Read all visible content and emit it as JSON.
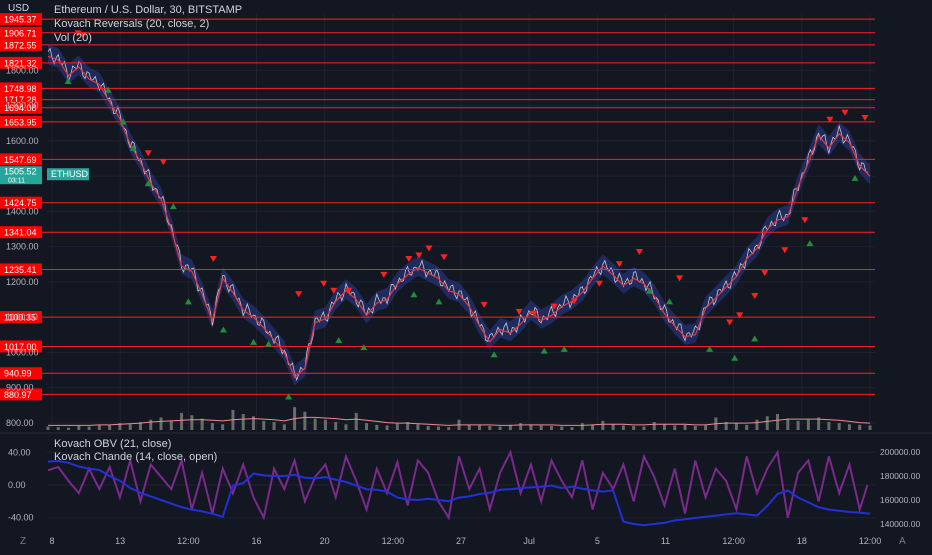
{
  "header": {
    "price_unit": "USD",
    "legend": [
      "Ethereum / U.S. Dollar, 30, BITSTAMP",
      "Kovach Reversals (20, close, 2)",
      "Vol (20)"
    ],
    "lower_legend": [
      "Kovach OBV (21, close)",
      "Kovach Chande (14, close, open)"
    ]
  },
  "footer": {
    "left_btn": "Z",
    "right_btn": "A"
  },
  "colors": {
    "background": "#131722",
    "level_line": "#ff1f1f",
    "level_label_bg": "#ff0000",
    "price_line": "#c9c9c9",
    "channel": "#2a3a8f",
    "signal_line": "#e8383d",
    "sell_marker": "#ff2020",
    "buy_marker": "#1f8f3a",
    "volume": "#6b6b6b",
    "volume_ma": "#f08a8a",
    "chande": "#7a2a8c",
    "obv": "#2230d8",
    "current_price_bg": "#26a69a"
  },
  "chart_data": [
    {
      "type": "line",
      "title": "Ethereum / U.S. Dollar, 30, BITSTAMP",
      "ylabel": "USD",
      "ylim": [
        780,
        1960
      ],
      "yticks": [
        800,
        900,
        1000,
        1100,
        1200,
        1300,
        1400,
        1500,
        1600,
        1700,
        1800
      ],
      "ytick_labels": [
        "800.00",
        "900.00",
        "1000.00",
        "1100.00",
        "1200.00",
        "1300.00",
        "1400.00",
        "1500.00",
        "1600.00",
        "1700.00",
        "1800.00"
      ],
      "grid": true,
      "x_ticks": [
        "8",
        "13",
        "12:00",
        "16",
        "20",
        "12:00",
        "27",
        "Jul",
        "5",
        "11",
        "12:00",
        "18",
        "12:00"
      ],
      "horizontal_levels": [
        1945.37,
        1906.71,
        1872.55,
        1821.32,
        1748.98,
        1717.28,
        1694.08,
        1653.95,
        1547.69,
        1424.75,
        1341.04,
        1235.41,
        1100.35,
        1017.0,
        940.99,
        880.97
      ],
      "last_price": {
        "label": "ETHUSD",
        "value": "1505.52",
        "countdown": "03:11"
      },
      "series": [
        {
          "values": [
            1845,
            1835,
            1790,
            1815,
            1780,
            1765,
            1715,
            1668,
            1595,
            1545,
            1485,
            1440,
            1355,
            1250,
            1235,
            1170,
            1095,
            1215,
            1175,
            1125,
            1105,
            1075,
            1040,
            1005,
            935,
            960,
            1090,
            1100,
            1150,
            1180,
            1155,
            1110,
            1145,
            1155,
            1200,
            1225,
            1245,
            1230,
            1215,
            1180,
            1170,
            1135,
            1080,
            1035,
            1070,
            1060,
            1085,
            1120,
            1095,
            1110,
            1135,
            1150,
            1175,
            1215,
            1250,
            1225,
            1195,
            1215,
            1200,
            1165,
            1115,
            1080,
            1050,
            1055,
            1130,
            1160,
            1190,
            1220,
            1270,
            1300,
            1355,
            1380,
            1390,
            1475,
            1545,
            1620,
            1585,
            1625,
            1600,
            1535,
            1505
          ]
        }
      ],
      "sell_signals": [
        {
          "x": 6,
          "y": 1905
        },
        {
          "x": 7,
          "y": 1900
        },
        {
          "x": 20,
          "y": 1565
        },
        {
          "x": 23,
          "y": 1540
        },
        {
          "x": 33,
          "y": 1265
        },
        {
          "x": 50,
          "y": 1165
        },
        {
          "x": 55,
          "y": 1195
        },
        {
          "x": 57,
          "y": 1175
        },
        {
          "x": 60,
          "y": 1175
        },
        {
          "x": 67,
          "y": 1220
        },
        {
          "x": 72,
          "y": 1265
        },
        {
          "x": 74,
          "y": 1275
        },
        {
          "x": 76,
          "y": 1295
        },
        {
          "x": 79,
          "y": 1270
        },
        {
          "x": 87,
          "y": 1135
        },
        {
          "x": 94,
          "y": 1115
        },
        {
          "x": 97,
          "y": 1110
        },
        {
          "x": 101,
          "y": 1130
        },
        {
          "x": 105,
          "y": 1145
        },
        {
          "x": 110,
          "y": 1195
        },
        {
          "x": 114,
          "y": 1250
        },
        {
          "x": 118,
          "y": 1285
        },
        {
          "x": 126,
          "y": 1210
        },
        {
          "x": 136,
          "y": 1085
        },
        {
          "x": 138,
          "y": 1105
        },
        {
          "x": 141,
          "y": 1160
        },
        {
          "x": 143,
          "y": 1225
        },
        {
          "x": 147,
          "y": 1290
        },
        {
          "x": 151,
          "y": 1375
        },
        {
          "x": 156,
          "y": 1660
        },
        {
          "x": 159,
          "y": 1680
        },
        {
          "x": 163,
          "y": 1665
        }
      ],
      "buy_signals": [
        {
          "x": 4,
          "y": 1770
        },
        {
          "x": 12,
          "y": 1745
        },
        {
          "x": 15,
          "y": 1655
        },
        {
          "x": 17,
          "y": 1580
        },
        {
          "x": 20,
          "y": 1480
        },
        {
          "x": 25,
          "y": 1415
        },
        {
          "x": 28,
          "y": 1145
        },
        {
          "x": 35,
          "y": 1065
        },
        {
          "x": 41,
          "y": 1030
        },
        {
          "x": 44,
          "y": 1025
        },
        {
          "x": 48,
          "y": 875
        },
        {
          "x": 58,
          "y": 1035
        },
        {
          "x": 63,
          "y": 1015
        },
        {
          "x": 73,
          "y": 1165
        },
        {
          "x": 78,
          "y": 1145
        },
        {
          "x": 89,
          "y": 995
        },
        {
          "x": 99,
          "y": 1005
        },
        {
          "x": 103,
          "y": 1010
        },
        {
          "x": 120,
          "y": 1175
        },
        {
          "x": 124,
          "y": 1145
        },
        {
          "x": 132,
          "y": 1010
        },
        {
          "x": 137,
          "y": 985
        },
        {
          "x": 141,
          "y": 1040
        },
        {
          "x": 152,
          "y": 1310
        },
        {
          "x": 161,
          "y": 1495
        }
      ]
    },
    {
      "type": "bar",
      "title": "Vol (20)",
      "values": [
        6,
        5,
        4,
        7,
        6,
        9,
        8,
        12,
        10,
        14,
        18,
        22,
        16,
        30,
        26,
        20,
        12,
        10,
        35,
        28,
        24,
        16,
        14,
        10,
        40,
        32,
        20,
        18,
        14,
        10,
        30,
        12,
        9,
        8,
        11,
        14,
        10,
        7,
        6,
        5,
        18,
        9,
        8,
        7,
        6,
        9,
        12,
        10,
        8,
        7,
        6,
        5,
        12,
        9,
        16,
        10,
        8,
        7,
        6,
        14,
        10,
        8,
        9,
        7,
        8,
        22,
        14,
        12,
        9,
        18,
        24,
        28,
        20,
        16,
        18,
        22,
        14,
        12,
        10,
        9,
        8
      ],
      "ma": [
        8,
        8,
        8,
        8,
        8,
        9,
        9,
        10,
        11,
        12,
        14,
        15,
        16,
        17,
        18,
        18,
        17,
        16,
        18,
        19,
        20,
        19,
        18,
        16,
        20,
        22,
        22,
        21,
        20,
        18,
        19,
        17,
        15,
        13,
        12,
        12,
        11,
        10,
        9,
        8,
        9,
        9,
        9,
        9,
        8,
        8,
        9,
        9,
        9,
        9,
        8,
        8,
        8,
        9,
        10,
        10,
        10,
        9,
        9,
        10,
        10,
        10,
        10,
        9,
        9,
        11,
        12,
        12,
        12,
        13,
        15,
        17,
        19,
        19,
        19,
        19,
        18,
        17,
        15,
        13,
        12
      ]
    },
    {
      "type": "line",
      "title": "Kovach OBV (21, close) / Kovach Chande (14, close, open)",
      "ylim_left": [
        -55,
        55
      ],
      "yticks_left": [
        "40.00",
        "0.00",
        "-40.00"
      ],
      "ylim_right": [
        135000,
        210000
      ],
      "yticks_right": [
        "200000.00",
        "180000.00",
        "160000.00",
        "140000.00"
      ],
      "series": [
        {
          "name": "Kovach Chande",
          "values": [
            18,
            22,
            5,
            -10,
            20,
            -5,
            22,
            -15,
            30,
            -20,
            25,
            10,
            -5,
            30,
            -30,
            15,
            -35,
            20,
            -10,
            25,
            -15,
            -40,
            20,
            -5,
            30,
            -20,
            10,
            25,
            -15,
            35,
            5,
            -30,
            20,
            -10,
            28,
            -25,
            30,
            15,
            -20,
            -40,
            35,
            -5,
            20,
            -30,
            15,
            40,
            -10,
            25,
            -20,
            30,
            5,
            -15,
            30,
            -30,
            15,
            -5,
            25,
            -20,
            35,
            10,
            -25,
            20,
            -35,
            30,
            -15,
            20,
            5,
            -30,
            35,
            -10,
            20,
            40,
            -40,
            15,
            30,
            -20,
            35,
            -10,
            25,
            -30,
            10
          ]
        },
        {
          "name": "Kovach OBV",
          "values": [
            192000,
            192500,
            191000,
            188000,
            186000,
            185000,
            180000,
            176000,
            170000,
            166000,
            163000,
            160000,
            157000,
            154000,
            152000,
            150500,
            148500,
            146000,
            172000,
            174000,
            182000,
            180500,
            180000,
            180000,
            181000,
            178500,
            178000,
            179000,
            177000,
            175000,
            172000,
            169000,
            168500,
            167000,
            162000,
            160500,
            160000,
            161000,
            160000,
            159000,
            162000,
            163000,
            165000,
            166000,
            168500,
            169000,
            170000,
            170500,
            171000,
            172000,
            170000,
            171000,
            169500,
            168000,
            167000,
            168000,
            142000,
            140000,
            139000,
            140000,
            141000,
            143000,
            144000,
            145000,
            146000,
            147000,
            148000,
            149000,
            148000,
            147000,
            155000,
            165000,
            168000,
            162000,
            158000,
            154000,
            152000,
            151000,
            150000,
            149500,
            148500
          ]
        }
      ]
    }
  ]
}
